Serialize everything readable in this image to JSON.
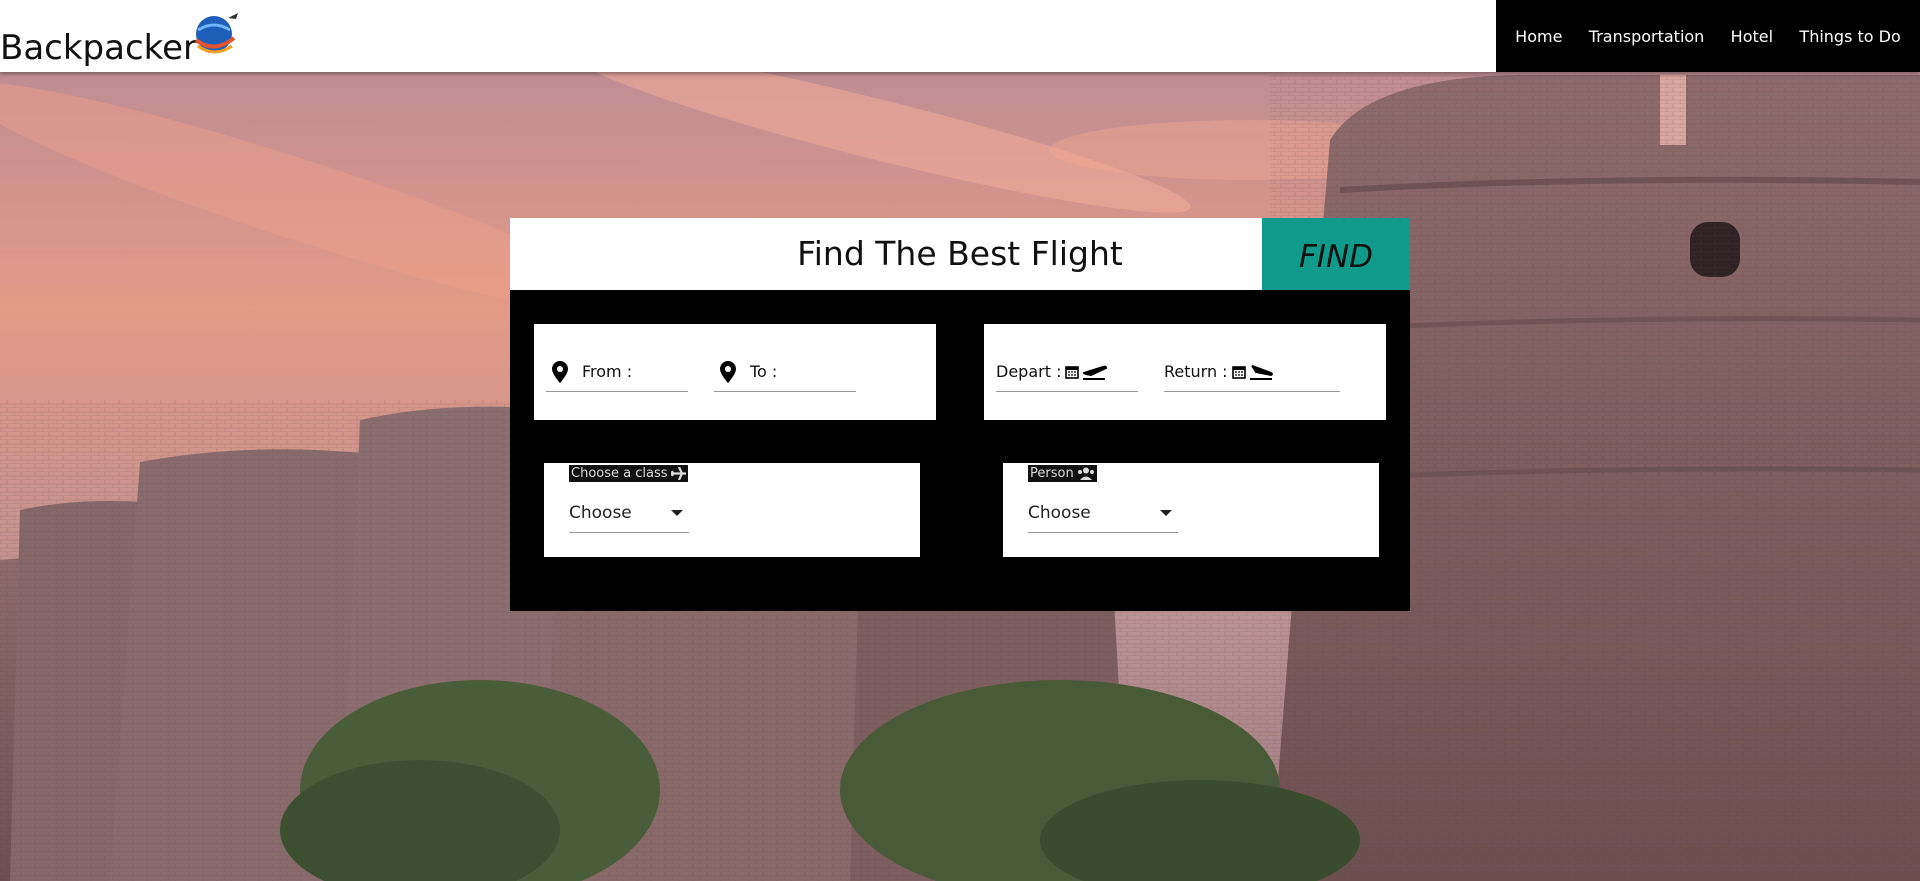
{
  "header": {
    "brand": "Backpacker",
    "logo_icon": "globe-plane-logo",
    "nav": [
      "Home",
      "Transportation",
      "Hotel",
      "Things to Do"
    ]
  },
  "finder": {
    "title": "Find The Best Flight",
    "find_label": "FIND",
    "from_label": "From :",
    "to_label": "To :",
    "depart_label": "Depart :",
    "return_label": "Return :",
    "class_label": "Choose a class",
    "class_value": "Choose",
    "person_label": "Person",
    "person_value": "Choose"
  },
  "colors": {
    "accent": "#0f9a8b",
    "nav_bg": "#000000",
    "card_body": "#000000"
  },
  "icons": {
    "location": "map-pin-icon",
    "calendar": "calendar-icon",
    "departure": "plane-departure-icon",
    "arrival": "plane-arrival-icon",
    "plane": "plane-icon",
    "people": "users-icon",
    "caret": "caret-down-icon"
  }
}
